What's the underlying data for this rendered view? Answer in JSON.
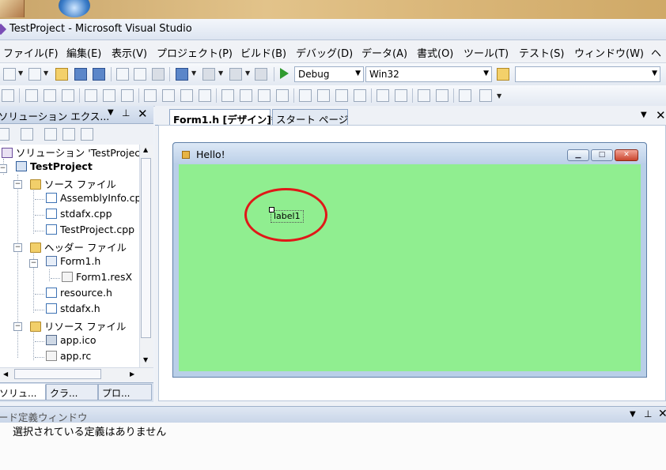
{
  "window": {
    "title": "TestProject - Microsoft Visual Studio"
  },
  "menu": [
    "ファイル(F)",
    "編集(E)",
    "表示(V)",
    "プロジェクト(P)",
    "ビルド(B)",
    "デバッグ(D)",
    "データ(A)",
    "書式(O)",
    "ツール(T)",
    "テスト(S)",
    "ウィンドウ(W)",
    "ヘ"
  ],
  "toolbar": {
    "configuration": "Debug",
    "platform": "Win32",
    "find_value": ""
  },
  "solution_explorer": {
    "title": "ソリューション エクス...",
    "items": [
      "ソリューション 'TestProject'",
      "TestProject",
      "ソース ファイル",
      "AssemblyInfo.cpp",
      "stdafx.cpp",
      "TestProject.cpp",
      "ヘッダー ファイル",
      "Form1.h",
      "Form1.resX",
      "resource.h",
      "stdafx.h",
      "リソース ファイル",
      "app.ico",
      "app.rc"
    ],
    "bottom_tabs": [
      "ソリュ...",
      "クラ...",
      "プロ..."
    ]
  },
  "document_tabs": [
    "Form1.h [デザイン]*",
    "スタート ページ"
  ],
  "form": {
    "caption": "Hello!",
    "label": "label1",
    "back_color": "#90ee90"
  },
  "code_definition": {
    "title": "ード定義ウィンドウ",
    "message": "選択されている定義はありません"
  }
}
